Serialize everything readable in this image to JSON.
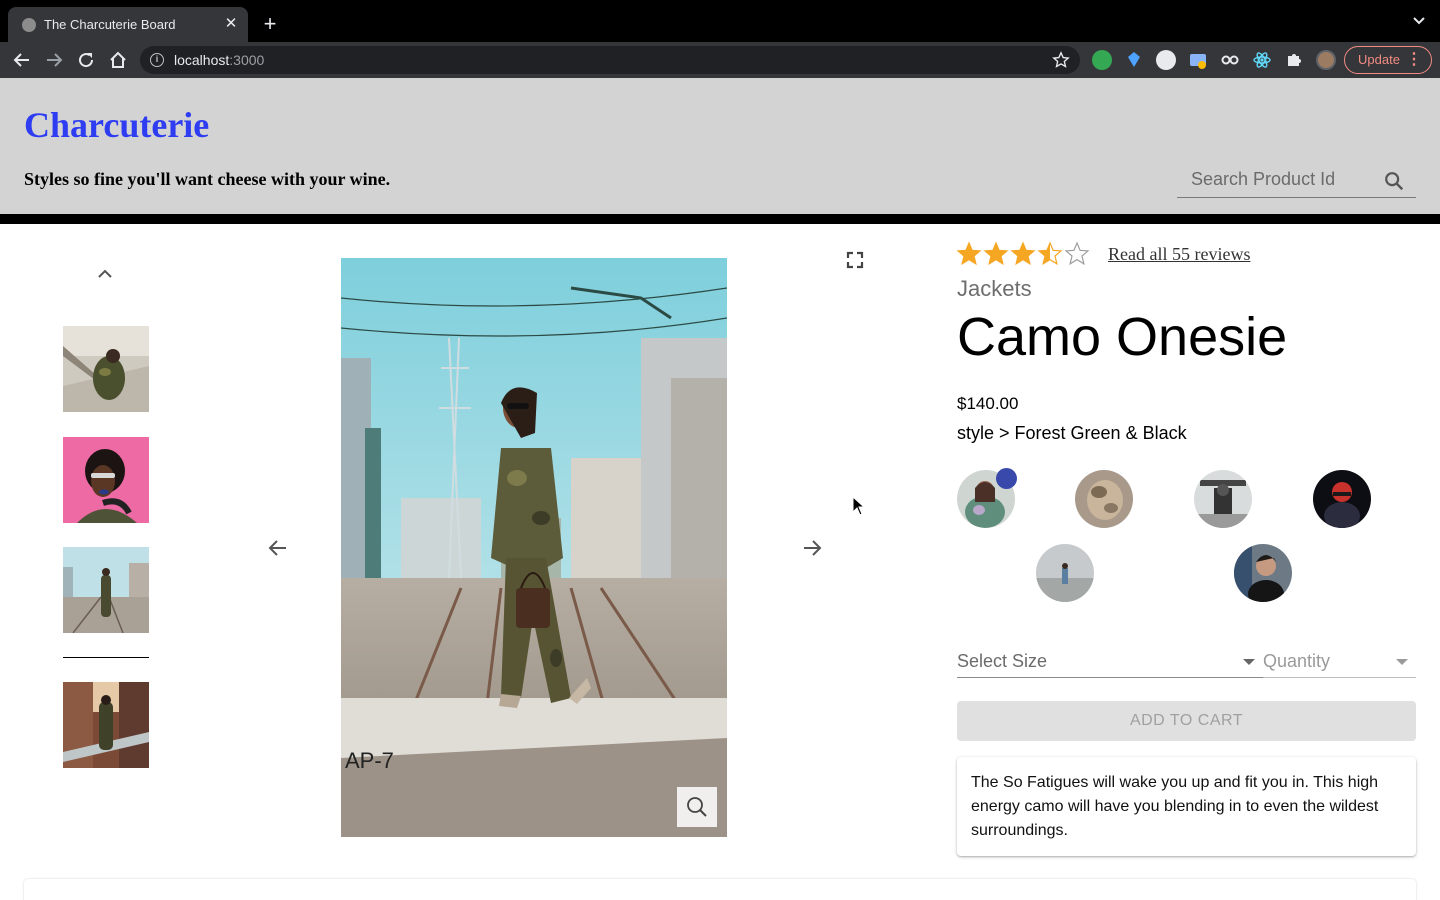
{
  "browser": {
    "tab_title": "The Charcuterie Board",
    "tab_close": "✕",
    "new_tab": "+",
    "url_host": "localhost",
    "url_port": ":3000",
    "update_label": "Update",
    "update_menu": "⋮"
  },
  "header": {
    "brand": "Charcuterie",
    "tagline": "Styles so fine you'll want cheese with your wine.",
    "search_placeholder": "Search Product Id"
  },
  "product": {
    "rating": 3.5,
    "rating_max": 5,
    "reviews_link": "Read all 55 reviews",
    "category": "Jackets",
    "name": "Camo Onesie",
    "price": "$140.00",
    "style_line": "style > Forest Green & Black",
    "size_placeholder": "Select Size",
    "quantity_placeholder": "Quantity",
    "add_to_cart": "ADD TO CART",
    "description": "The So Fatigues will wake you up and fit you in. This high energy camo will have you blending in to even the wildest surroundings."
  },
  "colors": {
    "brand": "#2e3df2",
    "header_bg": "#d3d3d3",
    "star": "#f5a623",
    "selected_dot": "#3949ab"
  }
}
